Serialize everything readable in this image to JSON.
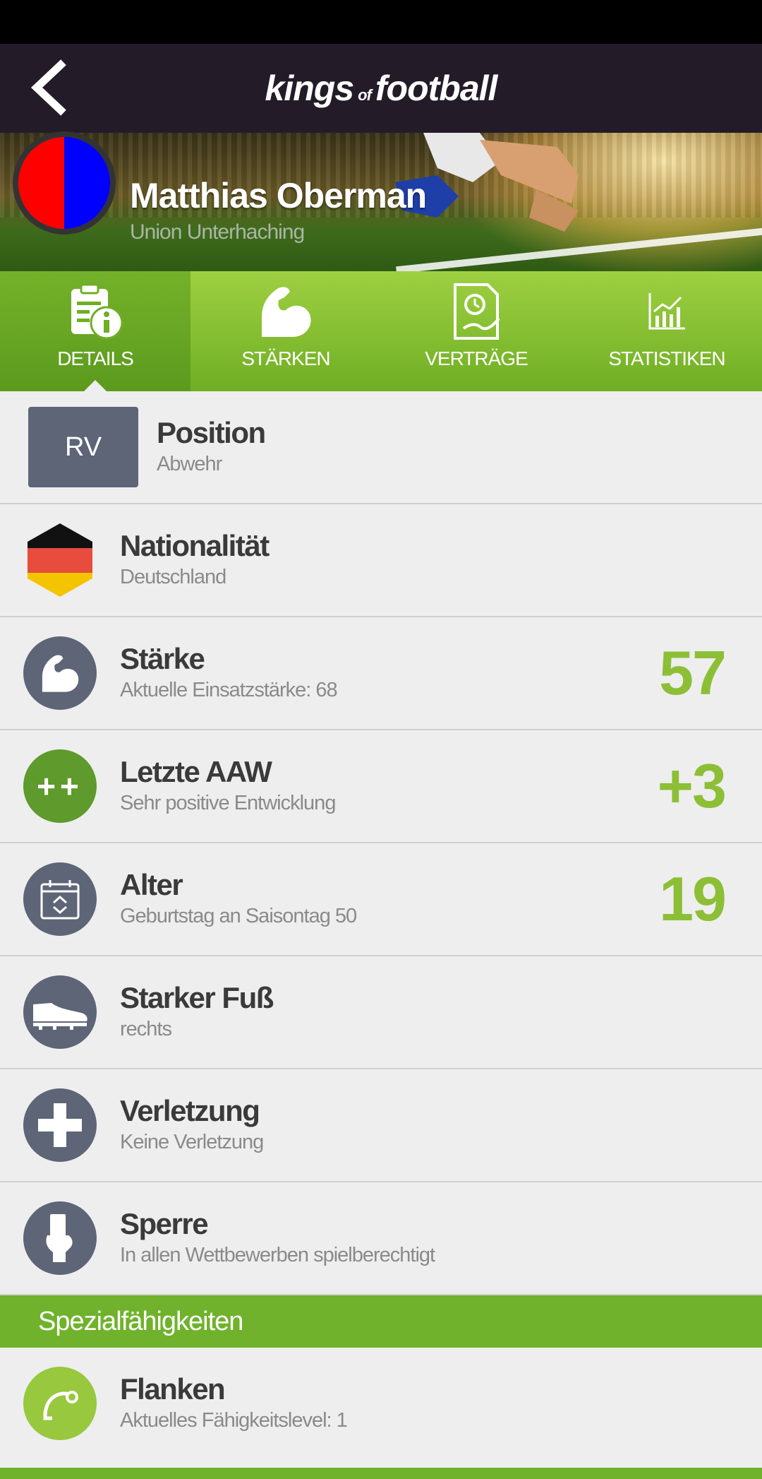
{
  "app": {
    "logo_left": "kings",
    "logo_of": "of",
    "logo_right": "football"
  },
  "player": {
    "name": "Matthias Oberman",
    "club": "Union Unterhaching",
    "club_colors": [
      "#ff0000",
      "#0000ff"
    ]
  },
  "tabs": [
    {
      "label": "DETAILS",
      "icon": "details-icon",
      "active": true
    },
    {
      "label": "STÄRKEN",
      "icon": "strength-icon",
      "active": false
    },
    {
      "label": "VERTRÄGE",
      "icon": "contract-icon",
      "active": false
    },
    {
      "label": "STATISTIKEN",
      "icon": "statistics-icon",
      "active": false
    }
  ],
  "rows": {
    "position": {
      "badge": "RV",
      "title": "Position",
      "sub": "Abwehr"
    },
    "nationality": {
      "title": "Nationalität",
      "sub": "Deutschland",
      "flag_colors": [
        "#111111",
        "#e84c3d",
        "#f5c400"
      ]
    },
    "strength": {
      "title": "Stärke",
      "sub": "Aktuelle Einsatzstärke: 68",
      "value": "57",
      "icon": "flexed-arm-icon"
    },
    "aaw": {
      "title": "Letzte AAW",
      "sub": "Sehr positive Entwicklung",
      "value": "+3",
      "badge": "++"
    },
    "age": {
      "title": "Alter",
      "sub": "Geburtstag an Saisontag 50",
      "value": "19",
      "icon": "calendar-icon"
    },
    "foot": {
      "title": "Starker Fuß",
      "sub": "rechts",
      "icon": "boot-icon"
    },
    "injury": {
      "title": "Verletzung",
      "sub": "Keine Verletzung",
      "icon": "medical-cross-icon"
    },
    "suspension": {
      "title": "Sperre",
      "sub": "In allen Wettbewerben spielberechtigt",
      "icon": "card-hand-icon"
    }
  },
  "special": {
    "header": "Spezialfähigkeiten",
    "items": [
      {
        "title": "Flanken",
        "sub": "Aktuelles Fähigkeitslevel: 1",
        "icon": "cross-curve-icon"
      }
    ]
  },
  "colors": {
    "accent": "#70b22b",
    "value": "#8cbf36",
    "icon_bg": "#5d6577",
    "app_bar": "#231c28"
  }
}
